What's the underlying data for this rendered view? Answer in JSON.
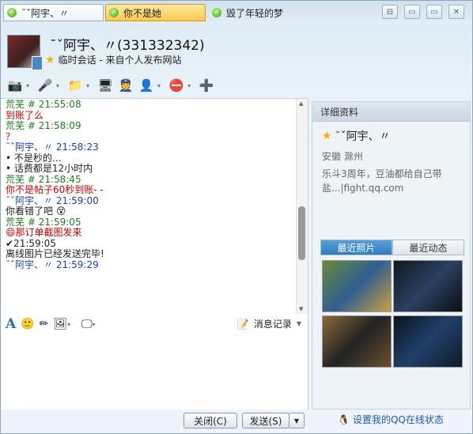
{
  "tabs": [
    {
      "label": "¯ˇ阿宇、〃"
    },
    {
      "label": "你不是她"
    },
    {
      "label": "毁了年轻的梦"
    }
  ],
  "window_buttons": [
    "⊟",
    "▭",
    "✕"
  ],
  "header": {
    "nickname": "¯ˇ阿宇、〃(331332342)",
    "subline": "临时会话 - 来自个人发布网站"
  },
  "messages": [
    {
      "text": "荒芜  #  21:55:08",
      "color": "g"
    },
    {
      "text": " 到账了么",
      "color": "r"
    },
    {
      "text": "荒芜  #  21:58:09",
      "color": "g"
    },
    {
      "text": " ？",
      "color": "r"
    },
    {
      "text": "   ¯ˇ阿宇、〃   21:58:23",
      "color": "b"
    },
    {
      "text": "• 不是秒的…",
      "color": ""
    },
    {
      "text": "• 话费都是12小时内",
      "color": ""
    },
    {
      "text": "荒芜  #  21:58:45",
      "color": "g"
    },
    {
      "text": " 你不是帖子60秒到账- -",
      "color": "r"
    },
    {
      "text": "   ¯ˇ阿宇、〃   21:59:00",
      "color": "b"
    },
    {
      "text": " 你看错了吧 😵",
      "color": ""
    },
    {
      "text": "荒芜  #  21:59:05",
      "color": "g"
    },
    {
      "text": " 😄那订单截图发来",
      "color": "r"
    },
    {
      "text": "✔21:59:05",
      "color": ""
    },
    {
      "text": " 离线图片已经发送完毕!",
      "color": ""
    },
    {
      "text": "   ¯ˇ阿宇、〃   21:59:29",
      "color": "b"
    }
  ],
  "editbar": {
    "history_label": "消息记录"
  },
  "buttons": {
    "close": "关闭(C)",
    "send": "发送(S)"
  },
  "panel": {
    "title": "详细资料",
    "name": "¯ˇ阿宇、〃",
    "location": "安徽    滁州",
    "signature": "乐斗3周年，豆油都给自己带盐...|fight.qq.com",
    "tab_photos": "最近照片",
    "tab_news": "最近动态",
    "qq_status_link": "设置我的QQ在线状态"
  }
}
